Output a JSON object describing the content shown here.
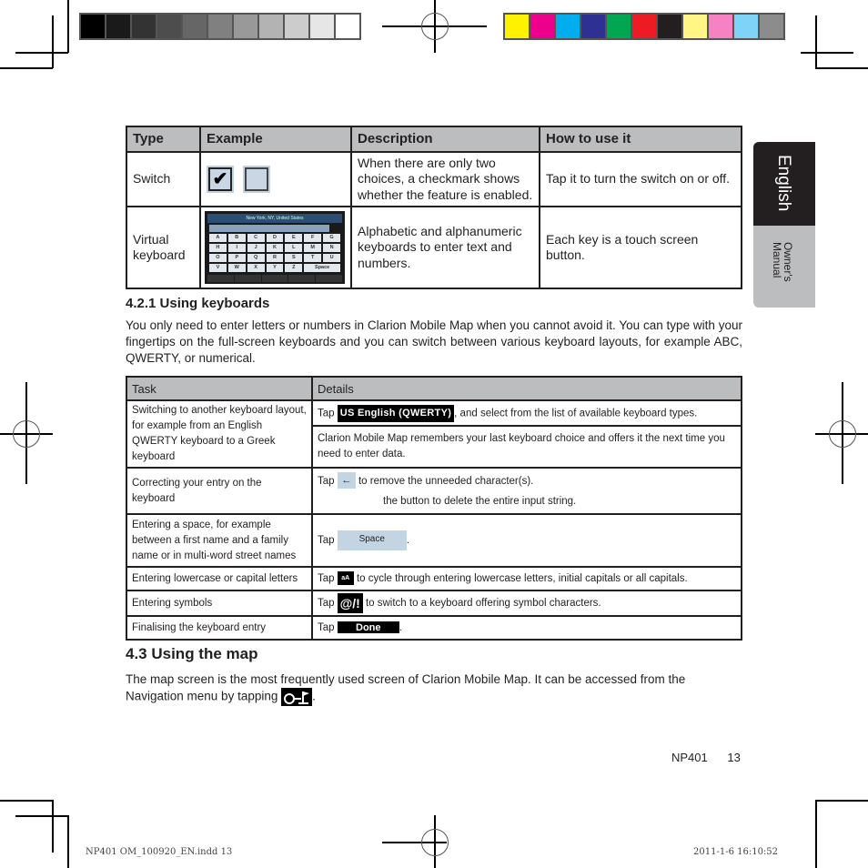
{
  "print_marks": {
    "grayscale_swatches": [
      "#000000",
      "#1a1a1a",
      "#333333",
      "#4d4d4d",
      "#666666",
      "#808080",
      "#999999",
      "#b3b3b3",
      "#cccccc",
      "#e6e6e6",
      "#ffffff"
    ],
    "color_swatches": [
      "#fff200",
      "#ec008c",
      "#00aeef",
      "#2e3192",
      "#00a651",
      "#ed1c24",
      "#231f20",
      "#fff685",
      "#f682c3",
      "#7fd3f7",
      "#8c8c8c"
    ],
    "slug_file": "NP401 OM_100920_EN.indd   13",
    "slug_date": "2011-1-6   16:10:52"
  },
  "side_tab": {
    "language": "English",
    "manual_line1": "Owner's",
    "manual_line2": "Manual"
  },
  "control_table": {
    "headers": [
      "Type",
      "Example",
      "Description",
      "How to use it"
    ],
    "rows": [
      {
        "type": "Switch",
        "example": "checkbox-checked, checkbox-unchecked",
        "check_glyph": "✔",
        "description": "When there are only two choices, a checkmark shows whether the feature is enabled.",
        "how": "Tap it to turn the switch on or off."
      },
      {
        "type": "Virtual keyboard",
        "example": "keyboard screenshot",
        "keyboard_title": "New York, NY, United States",
        "keyboard_keys": [
          "A",
          "B",
          "C",
          "D",
          "E",
          "F",
          "G",
          "H",
          "I",
          "J",
          "K",
          "L",
          "M",
          "N",
          "O",
          "P",
          "Q",
          "R",
          "S",
          "T",
          "U",
          "V",
          "W",
          "X",
          "Y",
          "Z",
          "Space"
        ],
        "description": "Alphabetic and alphanumeric keyboards to enter text and numbers.",
        "how": "Each key is a touch screen button."
      }
    ]
  },
  "section_421": {
    "heading": "4.2.1 Using keyboards",
    "paragraph": "You only need to enter letters or numbers in Clarion Mobile Map when you cannot avoid it. You can type with your fingertips on the full-screen keyboards and you can switch between various keyboard layouts, for example ABC, QWERTY, or numerical."
  },
  "task_table": {
    "headers": [
      "Task",
      "Details"
    ],
    "rows": [
      {
        "task": "Switching to another keyboard layout, for example from an English QWERTY keyboard to a Greek keyboard",
        "details": [
          {
            "pre": "Tap",
            "button": "US English (QWERTY)",
            "post": ", and select from the list of available keyboard types."
          },
          {
            "text": "Clarion Mobile Map remembers your last keyboard choice and offers it the next time you need to enter data."
          }
        ]
      },
      {
        "task": "Correcting your entry on the keyboard",
        "details_line1_pre": "Tap",
        "details_line1_icon": "←",
        "details_line1_post": "to remove the unneeded character(s).",
        "details_line2": "the button to delete the entire input string."
      },
      {
        "task": "Entering a space, for example between a first name and a family name or in multi-word street names",
        "pre": "Tap",
        "button": "Space",
        "post": "."
      },
      {
        "task": "Entering lowercase or capital letters",
        "pre": "Tap",
        "button": "aA",
        "post": "to cycle through entering lowercase letters, initial capitals or all capitals."
      },
      {
        "task": "Entering symbols",
        "pre": "Tap",
        "button": "@/!",
        "post": "to switch to a keyboard offering symbol characters."
      },
      {
        "task": "Finalising the keyboard entry",
        "pre": "Tap",
        "button": "Done",
        "post": "."
      }
    ]
  },
  "section_43": {
    "heading": "4.3 Using the map",
    "paragraph": "The map screen is the most frequently used screen of Clarion Mobile Map. It can be accessed from the Navigation menu by tapping",
    "icon": "navigation-map-icon",
    "end": "."
  },
  "footer": {
    "model": "NP401",
    "page": "13"
  }
}
